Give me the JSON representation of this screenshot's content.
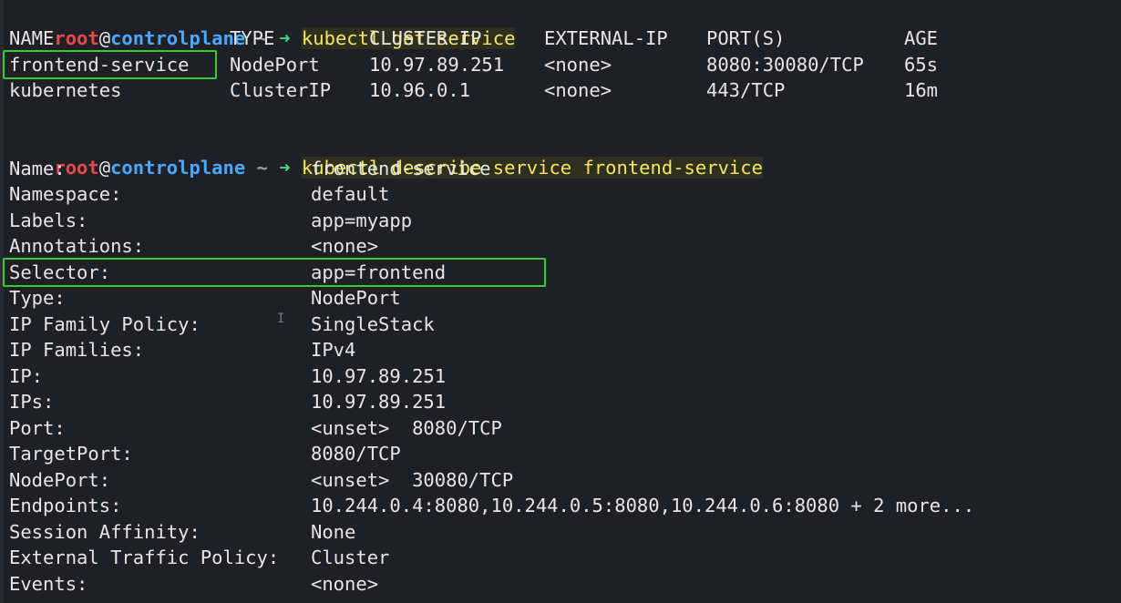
{
  "prompt": {
    "user": "root",
    "at": "@",
    "host": "controlplane",
    "tilde": "~",
    "arrow": "➜"
  },
  "commands": {
    "get": "kubectl get service",
    "describe": "kubectl describe service frontend-service"
  },
  "table": {
    "headers": [
      "NAME",
      "TYPE",
      "CLUSTER-IP",
      "EXTERNAL-IP",
      "PORT(S)",
      "AGE"
    ],
    "rows": [
      [
        "frontend-service",
        "NodePort",
        "10.97.89.251",
        "<none>",
        "8080:30080/TCP",
        "65s"
      ],
      [
        "kubernetes",
        "ClusterIP",
        "10.96.0.1",
        "<none>",
        "443/TCP",
        "16m"
      ]
    ]
  },
  "describe": [
    {
      "key": "Name:",
      "value": "frontend-service"
    },
    {
      "key": "Namespace:",
      "value": "default"
    },
    {
      "key": "Labels:",
      "value": "app=myapp"
    },
    {
      "key": "Annotations:",
      "value": "<none>"
    },
    {
      "key": "Selector:",
      "value": "app=frontend"
    },
    {
      "key": "Type:",
      "value": "NodePort"
    },
    {
      "key": "IP Family Policy:",
      "value": "SingleStack"
    },
    {
      "key": "IP Families:",
      "value": "IPv4"
    },
    {
      "key": "IP:",
      "value": "10.97.89.251"
    },
    {
      "key": "IPs:",
      "value": "10.97.89.251"
    },
    {
      "key": "Port:",
      "value": "<unset>  8080/TCP"
    },
    {
      "key": "TargetPort:",
      "value": "8080/TCP"
    },
    {
      "key": "NodePort:",
      "value": "<unset>  30080/TCP"
    },
    {
      "key": "Endpoints:",
      "value": "10.244.0.4:8080,10.244.0.5:8080,10.244.0.6:8080 + 2 more..."
    },
    {
      "key": "Session Affinity:",
      "value": "None"
    },
    {
      "key": "External Traffic Policy:",
      "value": "Cluster"
    },
    {
      "key": "Events:",
      "value": "<none>"
    }
  ],
  "colors": {
    "background": "#1f2026",
    "highlight_box": "#33cc33",
    "command_text": "#f5e663",
    "prompt_user": "#e5484d",
    "prompt_host": "#4aa8ff",
    "prompt_arrow": "#3ddc84"
  }
}
